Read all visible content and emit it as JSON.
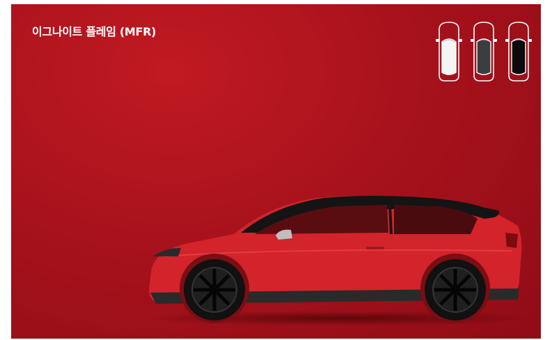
{
  "title": "이그나이트 플레임 (MFR)",
  "colors": {
    "background": "#b0141e",
    "car_body": "#d3232b"
  },
  "color_options": [
    {
      "name": "white",
      "hex": "#f4f4f4",
      "selected": false
    },
    {
      "name": "dark-gray",
      "hex": "#3c3d40",
      "selected": false
    },
    {
      "name": "black",
      "hex": "#0b0b0b",
      "selected": false
    }
  ]
}
